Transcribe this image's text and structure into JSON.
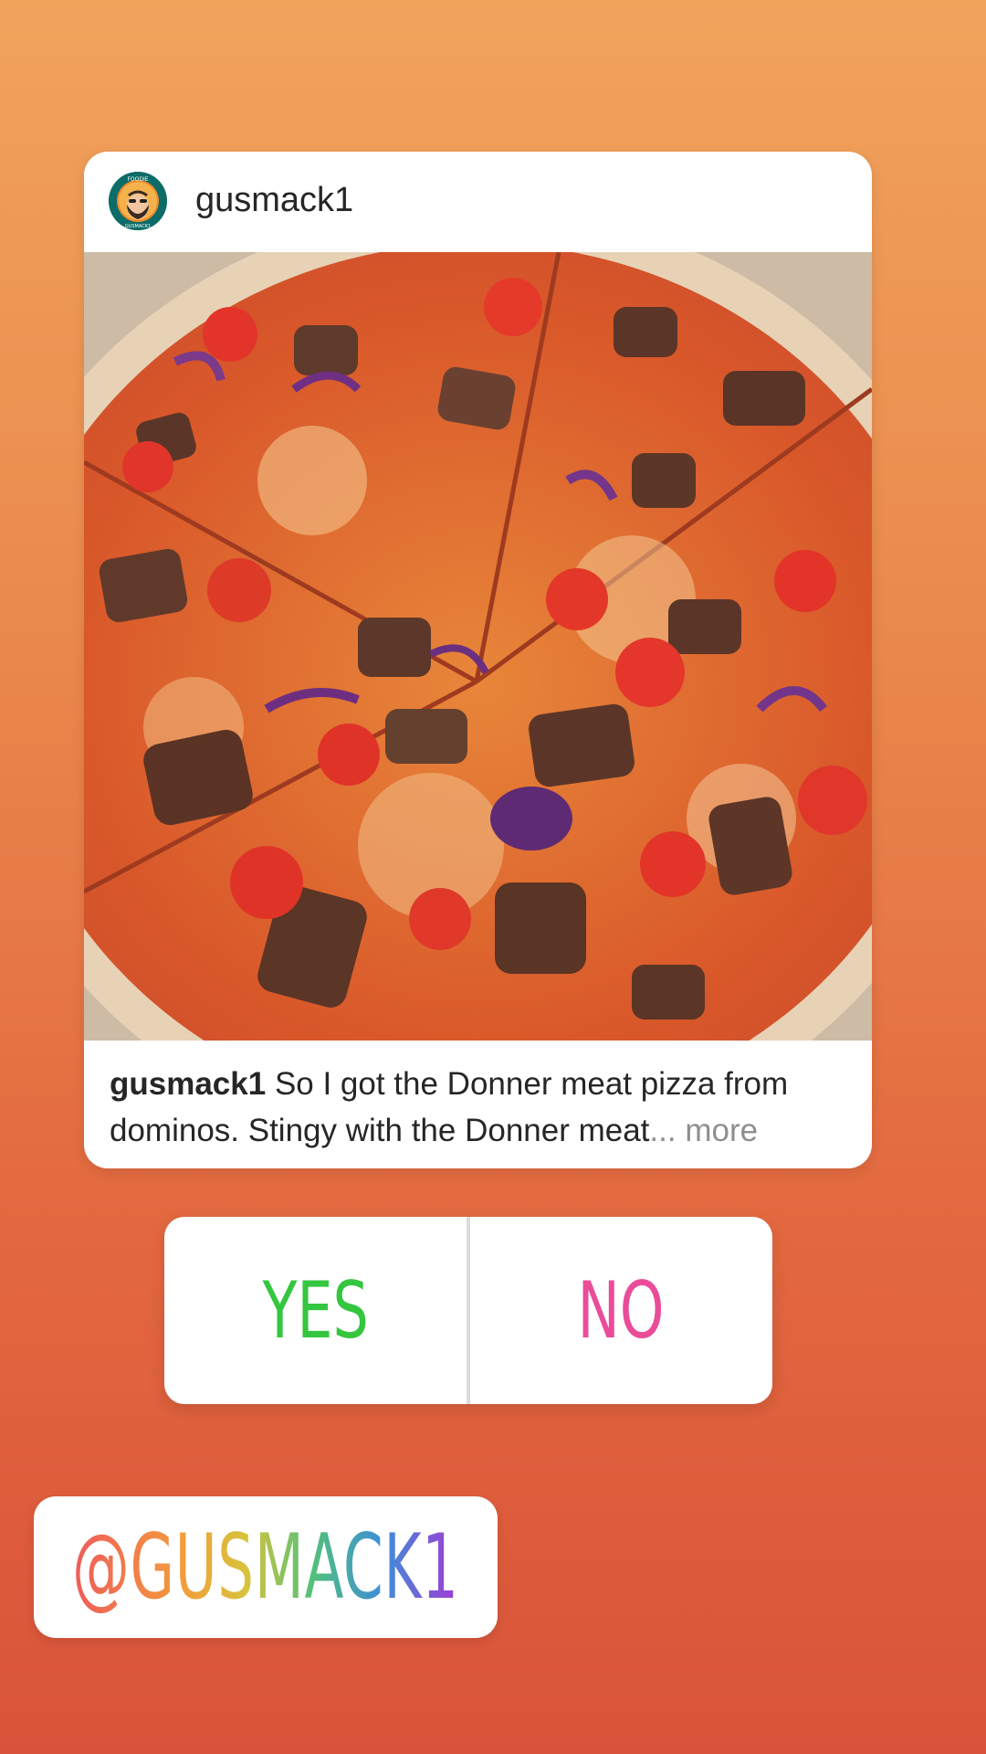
{
  "post": {
    "username": "gusmack1",
    "avatar_icon": "foodie-gusmack-logo",
    "image_icon": "pizza-photo",
    "caption_user": "gusmack1",
    "caption_text": " So I got the Donner meat pizza from dominos. Stingy with the Donner meat",
    "caption_more": "... more"
  },
  "avatar_text": {
    "top": "FOODIE",
    "bottom": "GUSMACK1"
  },
  "poll": {
    "yes_label": "YES",
    "no_label": "NO"
  },
  "mention": {
    "text": "@GUSMACK1"
  },
  "colors": {
    "yes": "#35c63f",
    "no": "#ea4c9a",
    "background_top": "#f1a35c",
    "background_bottom": "#d9533a"
  }
}
